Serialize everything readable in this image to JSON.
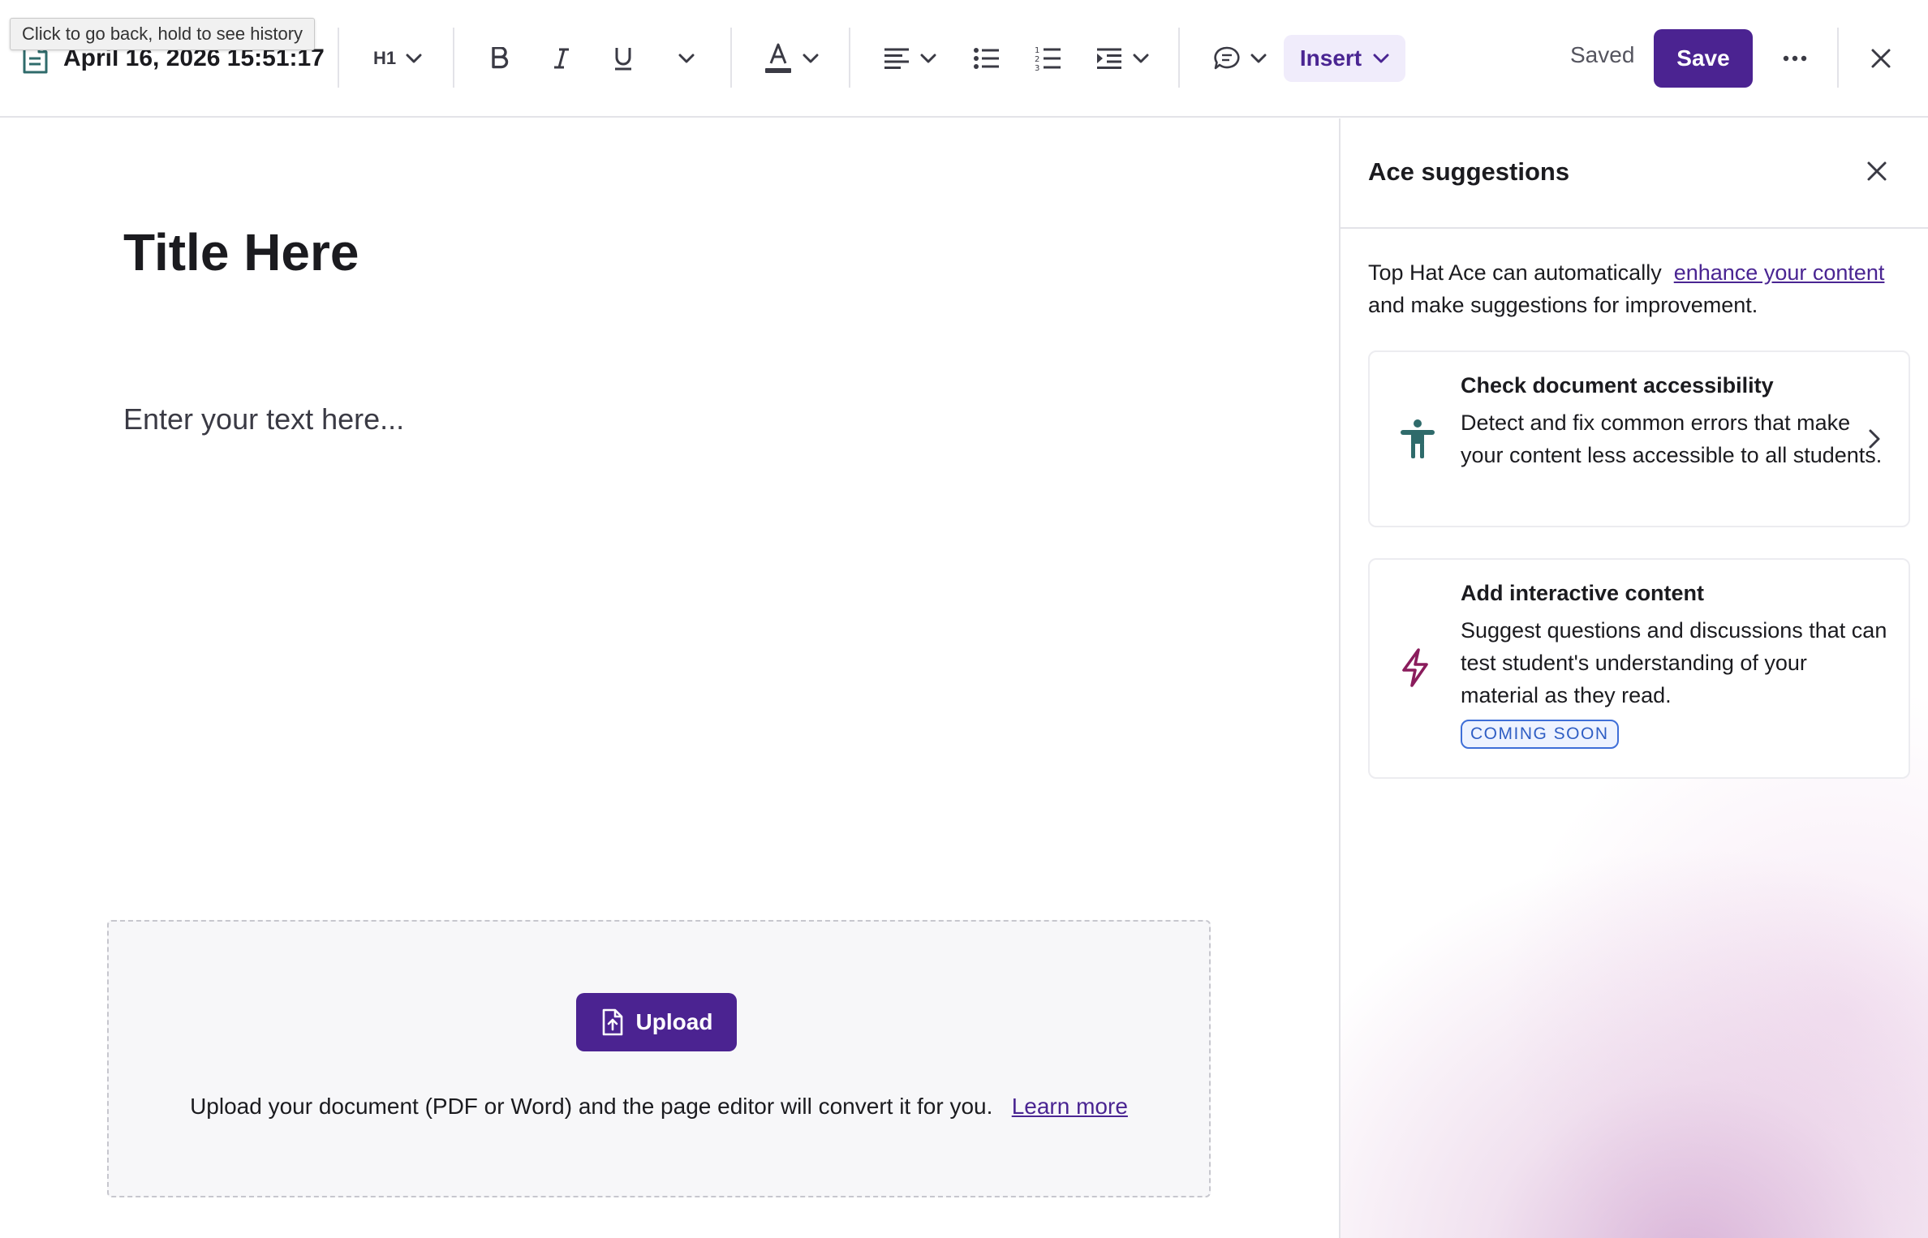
{
  "toolbar": {
    "tooltip": "Click to go back, hold to see history",
    "document_title": "April 16, 2026 15:51:17",
    "heading_selector_label": "H1",
    "insert_label": "Insert",
    "status_label": "Saved",
    "save_label": "Save"
  },
  "editor": {
    "title": "Title Here",
    "body_placeholder": "Enter your text here...",
    "upload": {
      "button_label": "Upload",
      "description": "Upload your document (PDF or Word) and the page editor will convert it for you.",
      "learn_more_label": "Learn more"
    }
  },
  "ace_panel": {
    "title": "Ace suggestions",
    "intro_prefix": "Top Hat Ace can automatically",
    "intro_link": "enhance your content",
    "intro_suffix": "and make suggestions for improvement.",
    "cards": [
      {
        "title": "Check document accessibility",
        "description": "Detect and fix common errors that make your content less accessible to all students.",
        "icon": "accessibility-icon"
      },
      {
        "title": "Add interactive content",
        "description": "Suggest questions and discussions that can test student's understanding of your material as they read.",
        "badge": "COMING SOON",
        "icon": "lightning-icon"
      }
    ]
  },
  "colors": {
    "brand_purple": "#4b2391",
    "insert_bg": "#f0ecfb",
    "accessibility_icon": "#2f6b6b",
    "lightning_icon": "#8a1c5c",
    "badge_blue": "#2f5ec4"
  }
}
